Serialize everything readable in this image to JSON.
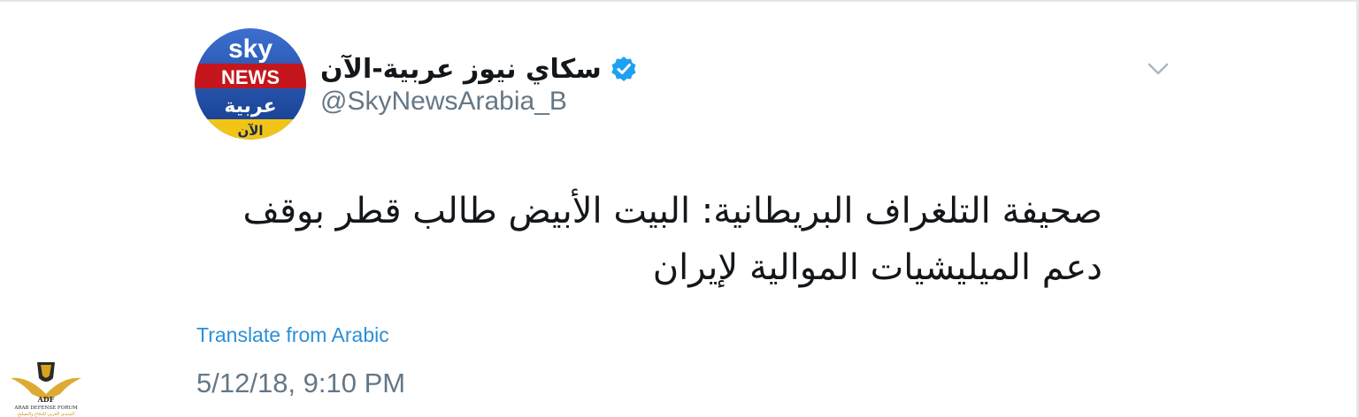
{
  "account": {
    "display_name": "سكاي نيوز عربية-الآن",
    "handle": "@SkyNewsArabia_B",
    "verified": true,
    "avatar": {
      "line1": "sky",
      "line2": "NEWS",
      "line3": "عربية",
      "line4": "الآن"
    }
  },
  "tweet": {
    "text": "صحيفة التلغراف البريطانية: البيت الأبيض طالب قطر بوقف دعم الميليشيات الموالية لإيران",
    "translate_label": "Translate from Arabic",
    "timestamp": "5/12/18, 9:10 PM"
  },
  "watermark": {
    "line1": "ADF",
    "line2": "ARAB DEFENSE FORUM",
    "line3": "المنتدى العربي للدفاع والتسليح"
  },
  "colors": {
    "text": "#14171a",
    "secondary": "#657786",
    "link": "#2b8fd6",
    "verified": "#1da1f2"
  },
  "icons": {
    "verified": "verified-badge-icon",
    "chevron": "chevron-down-icon"
  }
}
